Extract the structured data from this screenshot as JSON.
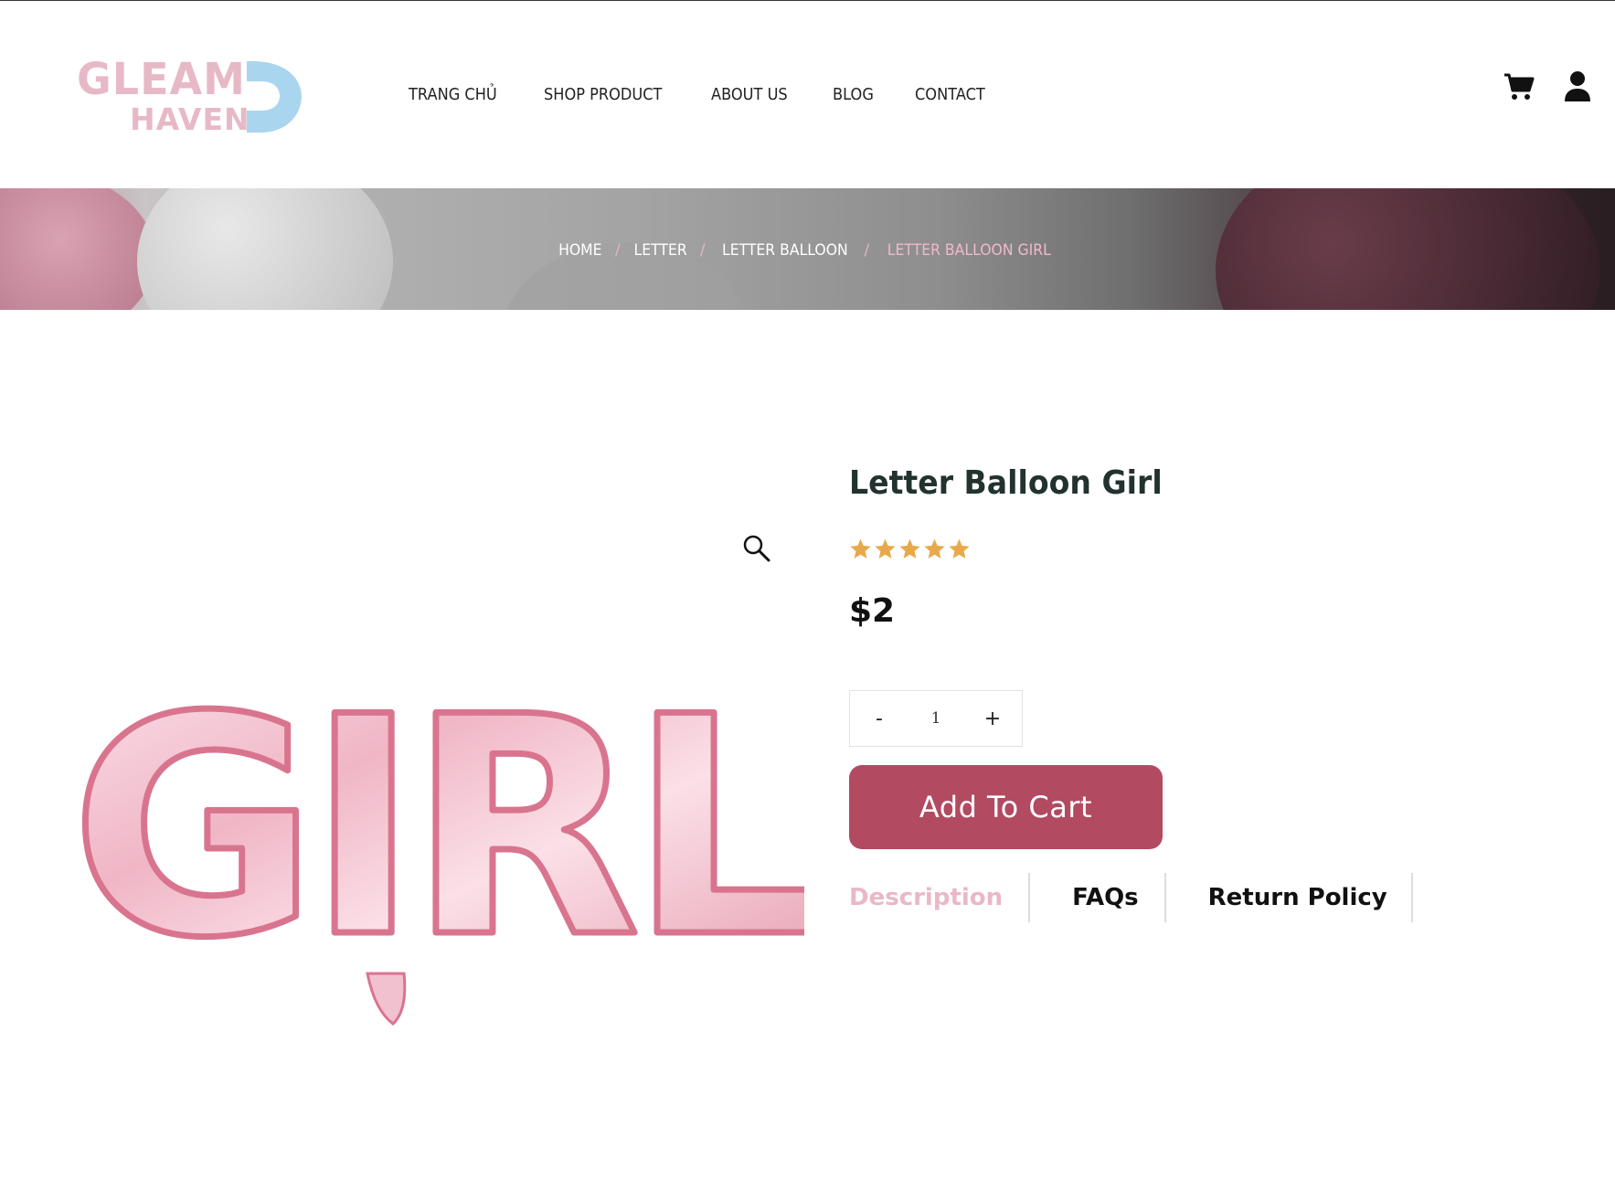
{
  "brand": {
    "line1": "GLEAM",
    "line2": "HAVEN"
  },
  "nav": {
    "items": [
      {
        "label": "TRANG CHỦ"
      },
      {
        "label": "SHOP PRODUCT"
      },
      {
        "label": "ABOUT US"
      },
      {
        "label": "BLOG"
      },
      {
        "label": "CONTACT"
      }
    ],
    "icons": [
      "cart-icon",
      "user-icon"
    ]
  },
  "breadcrumb": {
    "items": [
      "HOME",
      "LETTER",
      "LETTER BALLOON"
    ],
    "separator": "/",
    "current": "LETTER BALLOON GIRL"
  },
  "product": {
    "image_text": "GIRL",
    "title": "Letter Balloon Girl",
    "rating": 5,
    "rating_max": 5,
    "price": "$2",
    "quantity": "1",
    "qty_minus": "-",
    "qty_plus": "+",
    "add_to_cart": "Add To Cart"
  },
  "tabs": {
    "items": [
      {
        "label": "Description",
        "active": true
      },
      {
        "label": "FAQs",
        "active": false
      },
      {
        "label": "Return Policy",
        "active": false
      }
    ]
  },
  "colors": {
    "accent": "#b24a62",
    "pink": "#e9b8c6",
    "star": "#e8a94a",
    "logo_blue": "#a9d6ee"
  }
}
